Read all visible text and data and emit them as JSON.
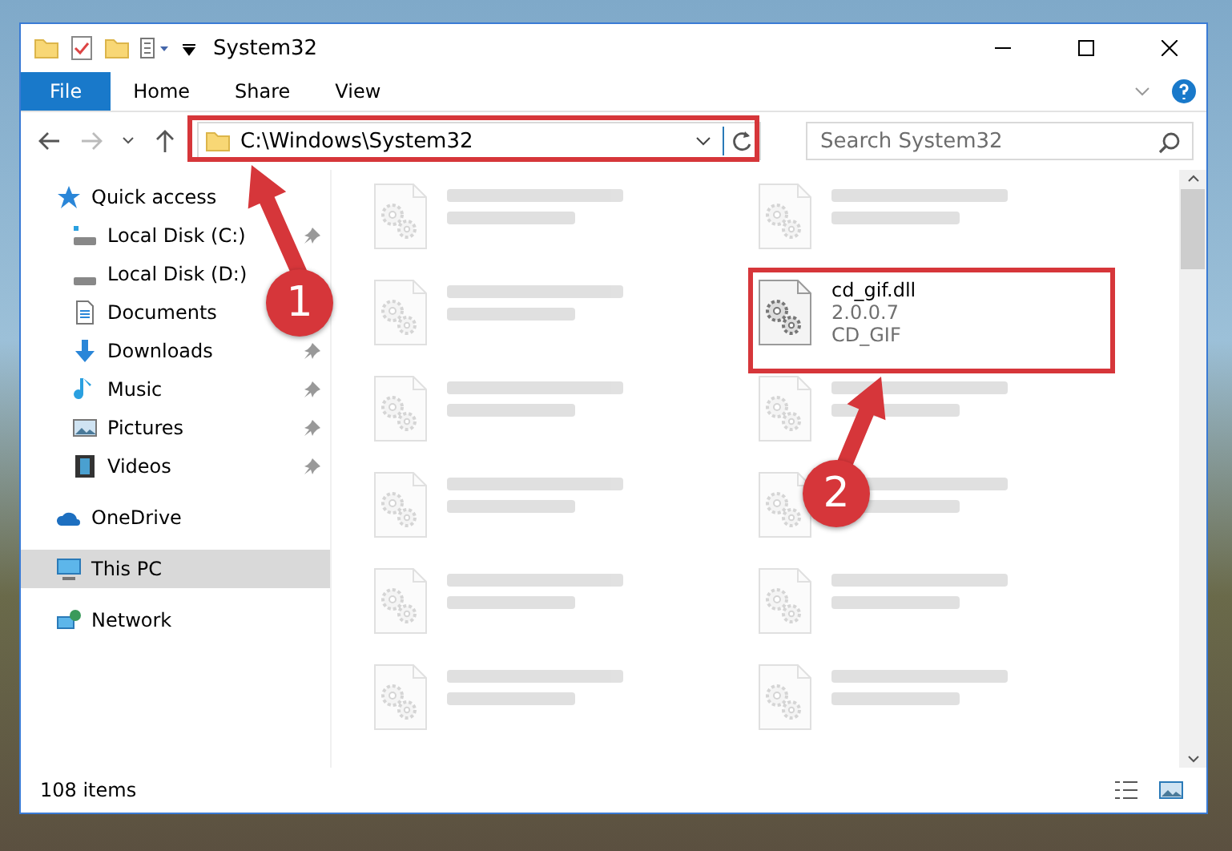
{
  "window": {
    "title": "System32"
  },
  "ribbon": {
    "tabs": [
      {
        "label": "File",
        "kind": "file"
      },
      {
        "label": "Home",
        "kind": "tab"
      },
      {
        "label": "Share",
        "kind": "tab"
      },
      {
        "label": "View",
        "kind": "tab"
      }
    ]
  },
  "address_bar": {
    "path": "C:\\Windows\\System32"
  },
  "search": {
    "placeholder": "Search System32"
  },
  "sidebar": {
    "items": [
      {
        "label": "Quick access",
        "kind": "star",
        "selected": false,
        "children": [
          {
            "label": "Local Disk (C:)",
            "kind": "drive-c",
            "pinned": true
          },
          {
            "label": "Local Disk (D:)",
            "kind": "drive",
            "pinned": false
          },
          {
            "label": "Documents",
            "kind": "documents",
            "pinned": false
          },
          {
            "label": "Downloads",
            "kind": "downloads",
            "pinned": true
          },
          {
            "label": "Music",
            "kind": "music",
            "pinned": true
          },
          {
            "label": "Pictures",
            "kind": "pictures",
            "pinned": true
          },
          {
            "label": "Videos",
            "kind": "videos",
            "pinned": true
          }
        ]
      },
      {
        "label": "OneDrive",
        "kind": "cloud",
        "selected": false
      },
      {
        "label": "This PC",
        "kind": "pc",
        "selected": true
      },
      {
        "label": "Network",
        "kind": "network",
        "selected": false
      }
    ]
  },
  "files": [
    {
      "kind": "faded"
    },
    {
      "kind": "faded"
    },
    {
      "kind": "faded"
    },
    {
      "name": "cd_gif.dll",
      "details": [
        "2.0.0.7",
        "CD_GIF"
      ],
      "kind": "focused"
    },
    {
      "kind": "faded"
    },
    {
      "kind": "faded"
    },
    {
      "kind": "faded"
    },
    {
      "kind": "faded"
    },
    {
      "kind": "faded"
    },
    {
      "kind": "faded"
    },
    {
      "kind": "faded"
    },
    {
      "kind": "faded"
    }
  ],
  "status_bar": {
    "count": "108 items"
  },
  "annotations": [
    {
      "number": "1"
    },
    {
      "number": "2"
    }
  ]
}
